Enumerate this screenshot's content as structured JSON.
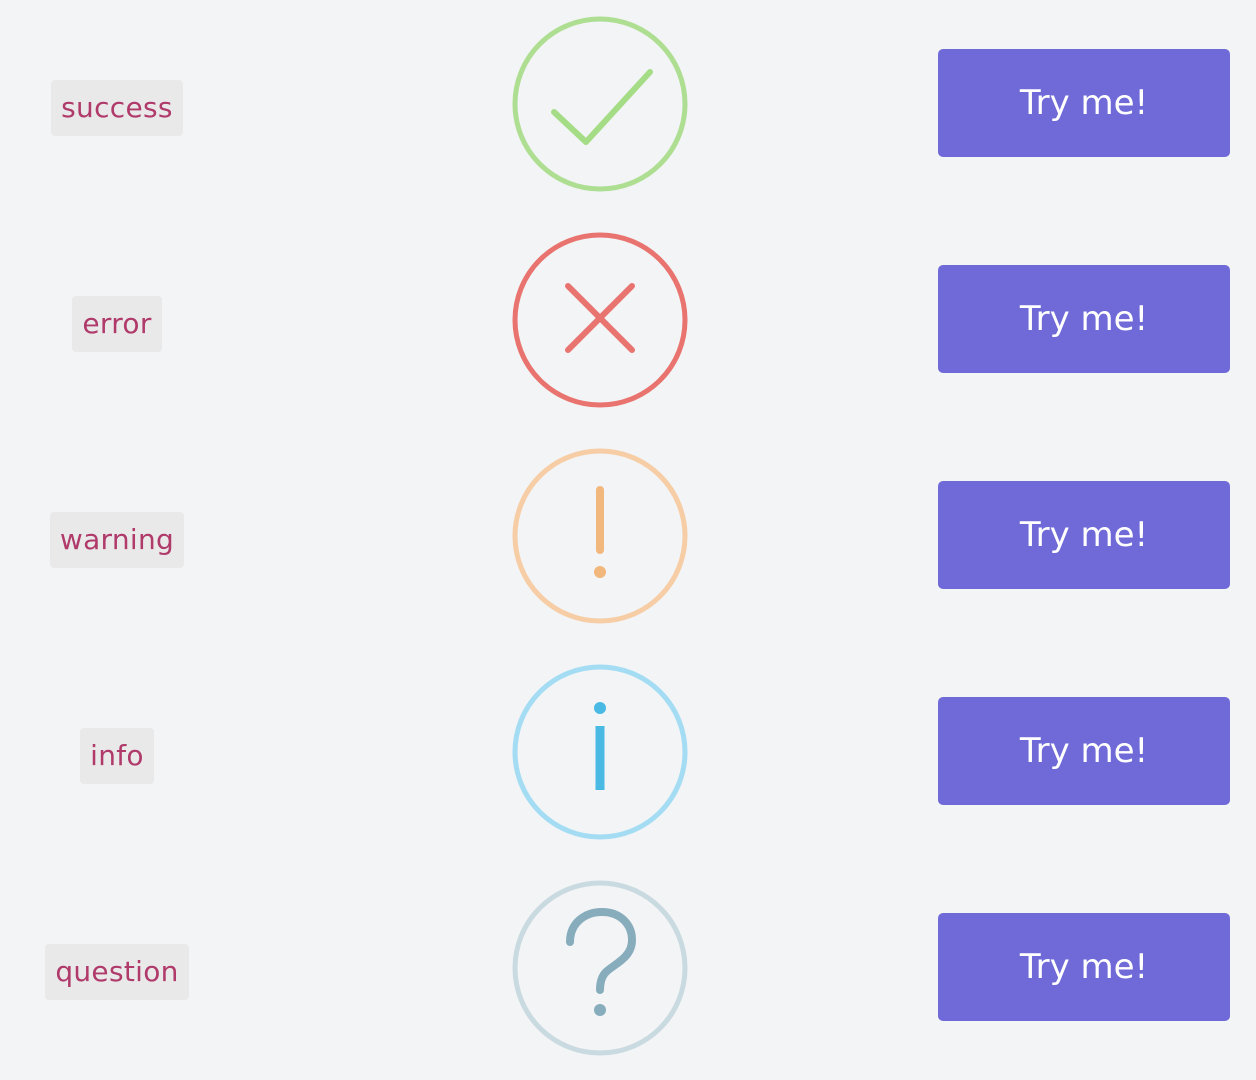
{
  "rows": [
    {
      "type": "success",
      "icon": "check-icon",
      "color": "#a5dc86",
      "button": "Try me!"
    },
    {
      "type": "error",
      "icon": "x-mark-icon",
      "color": "#f27474",
      "button": "Try me!"
    },
    {
      "type": "warning",
      "icon": "exclamation-icon",
      "color": "#f8bb86",
      "button": "Try me!"
    },
    {
      "type": "info",
      "icon": "info-icon",
      "color": "#3fc3ee",
      "button": "Try me!"
    },
    {
      "type": "question",
      "icon": "question-icon",
      "color": "#87adbd",
      "button": "Try me!"
    }
  ],
  "colors": {
    "background": "#f3f4f6",
    "label_bg": "#e9e9ea",
    "label_text": "#b03a6a",
    "button_bg": "#6f6ad8",
    "button_text": "#ffffff"
  }
}
